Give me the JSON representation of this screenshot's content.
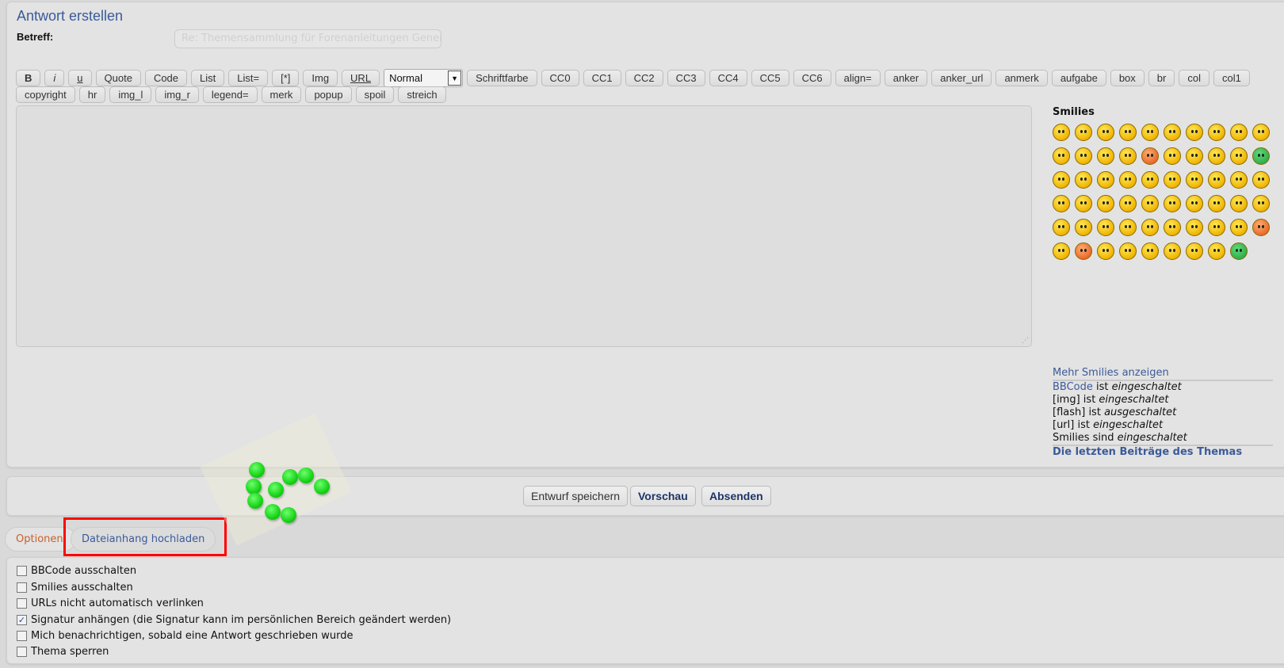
{
  "header": {
    "title": "Antwort erstellen",
    "subject_label": "Betreff:",
    "subject_value": "Re: Themensammlung für Forenanleitungen Genere"
  },
  "toolbar": {
    "row1": [
      "B",
      "i",
      "u",
      "Quote",
      "Code",
      "List",
      "List=",
      "[*]",
      "Img",
      "URL"
    ],
    "font_size_select": "Normal",
    "row1b": [
      "Schriftfarbe",
      "CC0",
      "CC1",
      "CC2",
      "CC3",
      "CC4",
      "CC5",
      "CC6",
      "align=",
      "anker",
      "anker_url",
      "anmerk",
      "aufgabe",
      "box",
      "br",
      "col",
      "col1"
    ],
    "row2": [
      "copyright",
      "hr",
      "img_l",
      "img_r",
      "legend=",
      "merk",
      "popup",
      "spoil",
      "streich"
    ]
  },
  "editor": {
    "value": ""
  },
  "smilies": {
    "title": "Smilies",
    "icons": [
      "shocked",
      "bat",
      "confused",
      "puppet",
      "nerd",
      "jump",
      "tongue",
      "hug",
      "party",
      "coffee",
      "wine-glass",
      "wine",
      "mouse-question",
      "mouse",
      "angry-red",
      "blue-ball",
      "sleep",
      "bird",
      "thumbs-up",
      "green-grin",
      "thumbs-two",
      "read",
      "smile",
      "smile2",
      "violin",
      "think",
      "wave",
      "laugh",
      "chick",
      "flat",
      "sing",
      "glasses",
      "smile3",
      "alien",
      "cry",
      "shout",
      "dizzy",
      "computer",
      "talk",
      "thumb",
      "wink",
      "grin",
      "rolleyes",
      "smile4",
      "surprised",
      "eek",
      "cool2",
      "sad",
      "cool",
      "mad",
      "razz",
      "evil-red",
      "twisted",
      "evil",
      "neutral",
      "exclaim",
      "question",
      "idea",
      "green-mrgreen"
    ],
    "more_link": "Mehr Smilies anzeigen",
    "status": [
      {
        "key": "BBCode",
        "text": " ist ",
        "state": "eingeschaltet"
      },
      {
        "key": "[img]",
        "text": " ist ",
        "state": "eingeschaltet"
      },
      {
        "key": "[flash]",
        "text": " ist ",
        "state": "ausgeschaltet"
      },
      {
        "key": "[url]",
        "text": " ist ",
        "state": "eingeschaltet"
      },
      {
        "key": "Smilies",
        "text": " sind ",
        "state": "eingeschaltet"
      }
    ],
    "last_posts_link": "Die letzten Beiträge des Themas"
  },
  "actions": {
    "save_draft": "Entwurf speichern",
    "preview": "Vorschau",
    "submit": "Absenden"
  },
  "tabs": [
    {
      "label": "Optionen",
      "color": "#c8602c"
    },
    {
      "label": "Dateianhang hochladen",
      "color": "#3b5a9a"
    }
  ],
  "highlight_color": "#ff0000",
  "options": [
    {
      "label": "BBCode ausschalten",
      "checked": false
    },
    {
      "label": "Smilies ausschalten",
      "checked": false
    },
    {
      "label": "URLs nicht automatisch verlinken",
      "checked": false
    },
    {
      "label": "Signatur anhängen (die Signatur kann im persönlichen Bereich geändert werden)",
      "checked": true
    },
    {
      "label": "Mich benachrichtigen, sobald eine Antwort geschrieben wurde",
      "checked": false
    },
    {
      "label": "Thema sperren",
      "checked": false
    }
  ]
}
